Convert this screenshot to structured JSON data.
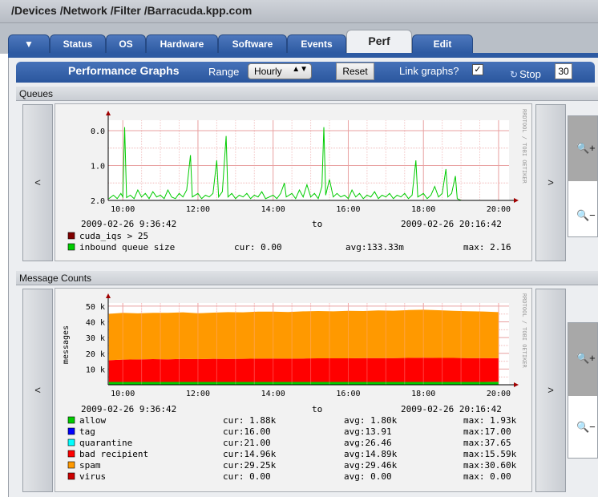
{
  "header": {
    "title": "/Devices /Network /Filter /Barracuda.kpp.com"
  },
  "tabs": [
    {
      "label": "▼",
      "active": false
    },
    {
      "label": "Status",
      "active": false
    },
    {
      "label": "OS",
      "active": false
    },
    {
      "label": "Hardware",
      "active": false
    },
    {
      "label": "Software",
      "active": false
    },
    {
      "label": "Events",
      "active": false
    },
    {
      "label": "Perf",
      "active": true
    },
    {
      "label": "Edit",
      "active": false
    }
  ],
  "toolbar": {
    "title": "Performance Graphs",
    "range_label": "Range",
    "range_value": "Hourly",
    "range_arrow": "▲▼",
    "reset_label": "Reset",
    "link_label": "Link graphs?",
    "link_checked": "✓",
    "stop_label": "Stop",
    "stop_icon": "↻",
    "refresh_seconds": "30"
  },
  "nav": {
    "prev": "<",
    "next": ">",
    "zoom_in_icon": "🔍+",
    "zoom_out_icon": "🔍−"
  },
  "colors": {
    "tab_blue": "#2d5aa2",
    "grid_red": "#f0b8b8",
    "green": "#00cc00",
    "orange": "#ff9900",
    "red": "#ff0000"
  },
  "chart_data": [
    {
      "section": "Queues",
      "type": "line",
      "watermark": "RRDTOOL / TOBI OETIKER",
      "yticks": [
        "2.0",
        "1.0",
        "0.0"
      ],
      "xticks": [
        "10:00",
        "12:00",
        "14:00",
        "16:00",
        "18:00",
        "20:00"
      ],
      "start": "2009-02-26 9:36:42",
      "to": "to",
      "end": "2009-02-26 20:16:42",
      "ylim": [
        0,
        2.3
      ],
      "legend": [
        {
          "name": "cuda_iqs > 25",
          "color": "#800000",
          "cur": "",
          "avg": "",
          "max": ""
        },
        {
          "name": "inbound queue size",
          "color": "#00cc00",
          "cur": "cur: 0.00",
          "avg": "avg:133.33m",
          "max": "max: 2.16"
        }
      ],
      "series": [
        {
          "name": "inbound queue size",
          "color": "#00cc00",
          "points": [
            [
              9.63,
              0.05
            ],
            [
              9.75,
              0.15
            ],
            [
              9.85,
              0.05
            ],
            [
              9.95,
              0.2
            ],
            [
              10.0,
              0.1
            ],
            [
              10.05,
              2.1
            ],
            [
              10.1,
              0.08
            ],
            [
              10.2,
              0.15
            ],
            [
              10.3,
              0.05
            ],
            [
              10.4,
              0.3
            ],
            [
              10.5,
              0.1
            ],
            [
              10.6,
              0.2
            ],
            [
              10.7,
              0.05
            ],
            [
              10.8,
              0.25
            ],
            [
              10.9,
              0.1
            ],
            [
              11.0,
              0.15
            ],
            [
              11.1,
              0.05
            ],
            [
              11.2,
              0.3
            ],
            [
              11.3,
              0.1
            ],
            [
              11.4,
              0.05
            ],
            [
              11.5,
              0.2
            ],
            [
              11.6,
              0.1
            ],
            [
              11.7,
              0.3
            ],
            [
              11.8,
              1.3
            ],
            [
              11.85,
              0.1
            ],
            [
              12.0,
              0.2
            ],
            [
              12.1,
              0.05
            ],
            [
              12.2,
              0.15
            ],
            [
              12.3,
              0.1
            ],
            [
              12.4,
              0.2
            ],
            [
              12.5,
              1.15
            ],
            [
              12.55,
              0.1
            ],
            [
              12.65,
              0.25
            ],
            [
              12.75,
              1.85
            ],
            [
              12.8,
              0.1
            ],
            [
              12.9,
              0.2
            ],
            [
              13.0,
              0.05
            ],
            [
              13.1,
              0.15
            ],
            [
              13.2,
              0.1
            ],
            [
              13.3,
              0.2
            ],
            [
              13.4,
              0.05
            ],
            [
              13.5,
              0.15
            ],
            [
              13.6,
              0.1
            ],
            [
              13.7,
              0.25
            ],
            [
              13.8,
              0.05
            ],
            [
              14.0,
              0.15
            ],
            [
              14.1,
              0.05
            ],
            [
              14.2,
              0.2
            ],
            [
              14.3,
              0.5
            ],
            [
              14.35,
              0.1
            ],
            [
              14.5,
              0.2
            ],
            [
              14.6,
              0.05
            ],
            [
              14.7,
              0.3
            ],
            [
              14.8,
              0.1
            ],
            [
              14.9,
              0.45
            ],
            [
              15.0,
              0.1
            ],
            [
              15.1,
              0.2
            ],
            [
              15.2,
              0.05
            ],
            [
              15.3,
              0.4
            ],
            [
              15.35,
              2.1
            ],
            [
              15.4,
              0.15
            ],
            [
              15.5,
              0.6
            ],
            [
              15.6,
              0.1
            ],
            [
              15.7,
              0.2
            ],
            [
              15.8,
              0.1
            ],
            [
              15.9,
              0.15
            ],
            [
              16.0,
              0.05
            ],
            [
              16.1,
              0.3
            ],
            [
              16.2,
              0.1
            ],
            [
              16.3,
              0.2
            ],
            [
              16.4,
              0.05
            ],
            [
              16.5,
              0.15
            ],
            [
              16.6,
              0.1
            ],
            [
              16.7,
              0.25
            ],
            [
              16.8,
              0.05
            ],
            [
              16.9,
              0.15
            ],
            [
              17.0,
              0.1
            ],
            [
              17.1,
              0.2
            ],
            [
              17.2,
              0.05
            ],
            [
              17.3,
              0.15
            ],
            [
              17.4,
              0.1
            ],
            [
              17.5,
              0.2
            ],
            [
              17.6,
              0.05
            ],
            [
              17.7,
              0.15
            ],
            [
              17.8,
              1.15
            ],
            [
              17.85,
              0.1
            ],
            [
              18.0,
              0.2
            ],
            [
              18.1,
              0.05
            ],
            [
              18.2,
              0.15
            ],
            [
              18.3,
              0.4
            ],
            [
              18.4,
              0.1
            ],
            [
              18.5,
              0.2
            ],
            [
              18.6,
              0.9
            ],
            [
              18.65,
              0.1
            ],
            [
              18.75,
              0.2
            ],
            [
              18.85,
              0.7
            ],
            [
              18.9,
              0.05
            ],
            [
              19.0,
              0.0
            ]
          ]
        }
      ]
    },
    {
      "section": "Message Counts",
      "type": "area",
      "watermark": "RRDTOOL / TOBI OETIKER",
      "ylabel": "messages",
      "yticks": [
        "50 k",
        "40 k",
        "30 k",
        "20 k",
        "10 k"
      ],
      "xticks": [
        "10:00",
        "12:00",
        "14:00",
        "16:00",
        "18:00",
        "20:00"
      ],
      "start": "2009-02-26 9:36:42",
      "to": "to",
      "end": "2009-02-26 20:16:42",
      "ylim": [
        0,
        52000
      ],
      "legend": [
        {
          "name": "allow",
          "color": "#00cc00",
          "cur": "cur: 1.88k",
          "avg": "avg: 1.80k",
          "max": "max: 1.93k"
        },
        {
          "name": "tag",
          "color": "#0000ff",
          "cur": "cur:16.00",
          "avg": "avg:13.91",
          "max": "max:17.00"
        },
        {
          "name": "quarantine",
          "color": "#00ffff",
          "cur": "cur:21.00",
          "avg": "avg:26.46",
          "max": "max:37.65"
        },
        {
          "name": "bad recipient",
          "color": "#ff0000",
          "cur": "cur:14.96k",
          "avg": "avg:14.89k",
          "max": "max:15.59k"
        },
        {
          "name": "spam",
          "color": "#ff9900",
          "cur": "cur:29.25k",
          "avg": "avg:29.46k",
          "max": "max:30.60k"
        },
        {
          "name": "virus",
          "color": "#cc0000",
          "cur": "cur: 0.00",
          "avg": "avg: 0.00",
          "max": "max: 0.00"
        }
      ],
      "x": [
        9.63,
        10.0,
        10.4,
        10.8,
        11.2,
        11.6,
        12.0,
        12.4,
        12.8,
        13.2,
        13.6,
        14.0,
        14.4,
        14.8,
        15.2,
        15.6,
        16.0,
        16.4,
        16.8,
        17.2,
        17.6,
        18.0,
        18.4,
        18.8,
        19.2,
        19.6,
        20.0
      ],
      "series": [
        {
          "name": "allow",
          "color": "#00cc00",
          "values": [
            1800,
            1800,
            1800,
            1800,
            1800,
            1800,
            1800,
            1800,
            1800,
            1800,
            1800,
            1800,
            1800,
            1800,
            1800,
            1800,
            1800,
            1800,
            1800,
            1800,
            1800,
            1800,
            1800,
            1800,
            1800,
            1800,
            1880
          ]
        },
        {
          "name": "bad recipient",
          "color": "#ff0000",
          "values": [
            13800,
            14200,
            14300,
            14500,
            14400,
            14600,
            14500,
            14700,
            14600,
            14700,
            14800,
            14900,
            14800,
            14900,
            15000,
            15000,
            15000,
            15100,
            15200,
            15200,
            15300,
            15400,
            15300,
            15300,
            15200,
            15200,
            15000
          ]
        },
        {
          "name": "spam",
          "color": "#ff9900",
          "values": [
            29500,
            29800,
            29300,
            29500,
            29600,
            29700,
            29200,
            29400,
            29800,
            29600,
            29900,
            29800,
            29700,
            30000,
            30100,
            29900,
            30200,
            30000,
            30300,
            30100,
            30400,
            30500,
            30300,
            29900,
            29800,
            29600,
            29300
          ]
        }
      ]
    }
  ]
}
